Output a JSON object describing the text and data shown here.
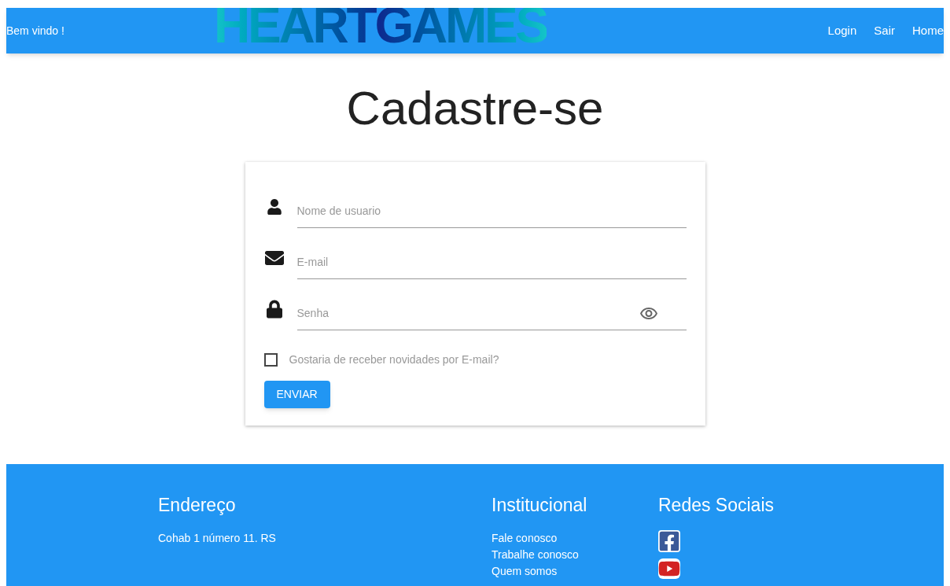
{
  "header": {
    "welcome": "Bem vindo !",
    "logo": "HEARTGAMES",
    "nav": [
      "Login",
      "Sair",
      "Home"
    ]
  },
  "title": "Cadastre-se",
  "form": {
    "fields": [
      {
        "kind": "user",
        "placeholder": "Nome de usuario"
      },
      {
        "kind": "email",
        "placeholder": "E-mail"
      },
      {
        "kind": "password",
        "placeholder": "Senha"
      }
    ],
    "newsletter": {
      "label": "Gostaria de receber novidades por E-mail?",
      "checked": false
    },
    "submit": "ENVIAR"
  },
  "footer": {
    "address": {
      "heading": "Endereço",
      "text": "Cohab 1 número 11. RS"
    },
    "institutional": {
      "heading": "Institucional",
      "links": [
        "Fale conosco",
        "Trabalhe conosco",
        "Quem somos"
      ]
    },
    "social": {
      "heading": "Redes Sociais",
      "links": [
        {
          "kind": "facebook"
        },
        {
          "kind": "youtube"
        }
      ]
    }
  }
}
